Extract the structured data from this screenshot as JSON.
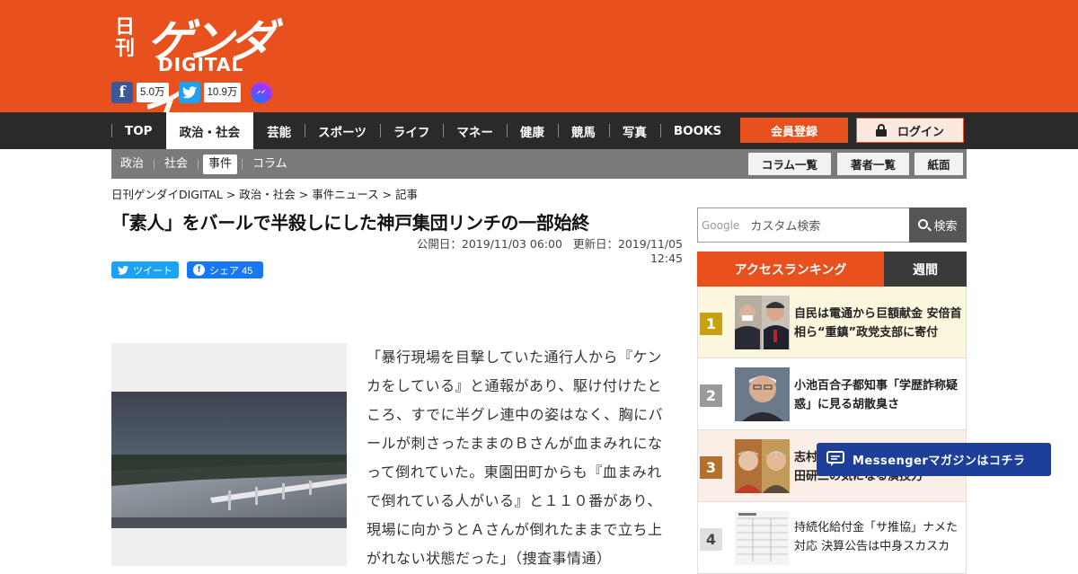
{
  "logo": {
    "nikkan": "日刊",
    "gendai": "ゲンダイ",
    "digital": "DIGITAL"
  },
  "social": {
    "facebook_count": "5.0万",
    "twitter_count": "10.9万"
  },
  "nav": {
    "items": [
      "TOP",
      "政治・社会",
      "芸能",
      "スポーツ",
      "ライフ",
      "マネー",
      "健康",
      "競馬",
      "写真",
      "BOOKS"
    ],
    "active": "政治・社会",
    "register": "会員登録",
    "login": "ログイン"
  },
  "subnav": {
    "items": [
      "政治",
      "社会",
      "事件",
      "コラム"
    ],
    "active": "事件",
    "buttons": [
      "コラム一覧",
      "著者一覧",
      "紙面"
    ]
  },
  "breadcrumb": "日刊ゲンダイDIGITAL > 政治・社会 > 事件ニュース > 記事",
  "article": {
    "title": "「素人」をバールで半殺しにした神戸集団リンチの一部始終",
    "published": "公開日：2019/11/03 06:00",
    "updated": "更新日：2019/11/05 12:45",
    "share_tweet": "ツイート",
    "share_fb": "シェア 45",
    "body_lines": [
      "「暴行現場を目撃していた通行人から『ケン",
      "カをしている』と通報があり、駆け付けたと",
      "ころ、すでに半グレ連中の姿はなく、胸にバ",
      "ールが刺さったままのＢさんが血まみれにな",
      "って倒れていた。東園田町からも『血まみれ",
      "で倒れている人がいる』と１１０番があり、",
      "現場に向かうとＡさんが倒れたままで立ち上",
      "がれない状態だった」（捜査事情通）"
    ]
  },
  "search": {
    "google_label": "Google",
    "placeholder": "カスタム検索",
    "button": "検索"
  },
  "ranking": {
    "tab_access": "アクセスランキング",
    "tab_weekly": "週間",
    "items": [
      {
        "rank": "1",
        "color": "#c9a10e",
        "text": "自民は電通から巨額献金 安倍首相ら“重鎮”政党支部に寄付"
      },
      {
        "rank": "2",
        "color": "#9a9a9a",
        "text": "小池百合子都知事「学歴詐称疑惑」に見る胡散臭さ"
      },
      {
        "rank": "3",
        "color": "#b5702c",
        "text": "志村けんさんと…\n田研二の気になる演技力"
      },
      {
        "rank": "4",
        "color": "#e0e0e0",
        "text": "持続化給付金「サ推協」ナメた対応 決算公告は中身スカスカ"
      }
    ]
  },
  "messenger": {
    "label": "Messengerマガジンはコチラ"
  }
}
